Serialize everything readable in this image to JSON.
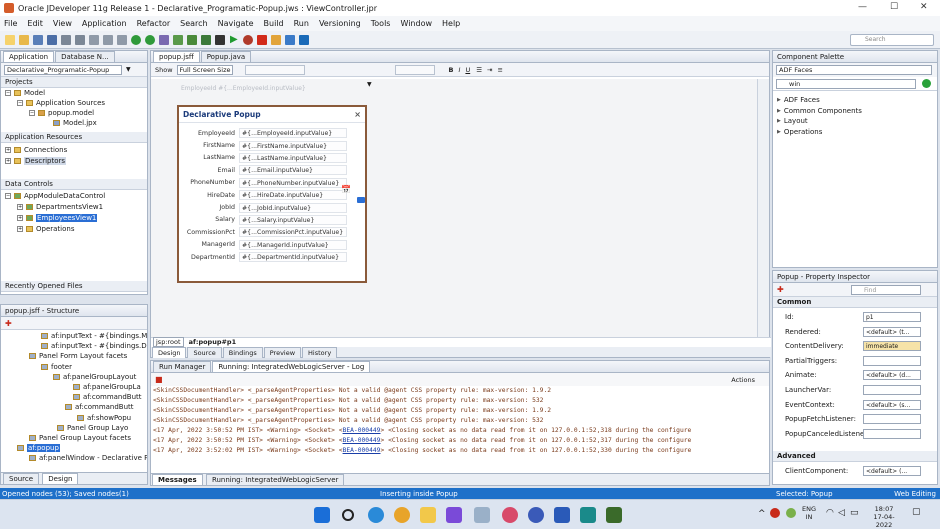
{
  "window": {
    "title": "Oracle JDeveloper 11g Release 1 - Declarative_Programatic-Popup.jws : ViewController.jpr"
  },
  "menu": [
    "File",
    "Edit",
    "View",
    "Application",
    "Refactor",
    "Search",
    "Navigate",
    "Build",
    "Run",
    "Versioning",
    "Tools",
    "Window",
    "Help"
  ],
  "search": {
    "placeholder": "Search"
  },
  "app_nav": {
    "tabs": [
      "Application",
      "Database N..."
    ],
    "project_select": "Declarative_Programatic-Popup",
    "projects_label": "Projects",
    "tree": [
      "Model",
      "Application Sources",
      "popup.model",
      "Model.jpx"
    ],
    "app_resources": "Application Resources",
    "resources_tree": [
      "Connections",
      "Descriptors"
    ],
    "data_controls": "Data Controls",
    "dc_tree": [
      "AppModuleDataControl",
      "DepartmentsView1",
      "EmployeesView1",
      "Operations"
    ],
    "recent": "Recently Opened Files"
  },
  "structure": {
    "title": "popup.jsff - Structure",
    "tree": [
      "af:inputText - #{bindings.Ma",
      "af:inputText - #{bindings.De",
      "Panel Form Layout facets",
      "footer",
      "af:panelGroupLayout",
      "af:panelGroupLa",
      "af:commandButt",
      "af:commandButt",
      "af:showPopu",
      "Panel Group Layo",
      "Panel Group Layout facets",
      "af:popup",
      "af:panelWindow - Declarative Pop"
    ],
    "tabs": [
      "Source",
      "Design"
    ]
  },
  "editor": {
    "tabs": [
      "popup.jsff",
      "Popup.java"
    ],
    "show_label": "Show",
    "screen_select": "Full Screen Size",
    "bg_hint": "EmployeeId  #{...EmployeeId.inputValue}",
    "breadcrumb": [
      "jsp:root",
      "af:popup#p1"
    ],
    "bottom_tabs": [
      "Design",
      "Source",
      "Bindings",
      "Preview",
      "History"
    ]
  },
  "dialog": {
    "title": "Declarative Popup",
    "close": "×",
    "rows": [
      {
        "label": "EmployeeId",
        "value": "#{...EmployeeId.inputValue}"
      },
      {
        "label": "FirstName",
        "value": "#{...FirstName.inputValue}"
      },
      {
        "label": "LastName",
        "value": "#{...LastName.inputValue}"
      },
      {
        "label": "Email",
        "value": "#{...Email.inputValue}"
      },
      {
        "label": "PhoneNumber",
        "value": "#{...PhoneNumber.inputValue}"
      },
      {
        "label": "HireDate",
        "value": "#{...HireDate.inputValue}"
      },
      {
        "label": "JobId",
        "value": "#{...JobId.inputValue}"
      },
      {
        "label": "Salary",
        "value": "#{...Salary.inputValue}"
      },
      {
        "label": "CommissionPct",
        "value": "#{...CommissionPct.inputValue}"
      },
      {
        "label": "ManagerId",
        "value": "#{...ManagerId.inputValue}"
      },
      {
        "label": "DepartmentId",
        "value": "#{...DepartmentId.inputValue}"
      }
    ]
  },
  "log": {
    "tabs": [
      "Run Manager",
      "Running: IntegratedWebLogicServer - Log"
    ],
    "actions": "Actions",
    "lines": [
      {
        "pre": "<SkinCSSDocumentHandler> <_parseAgentProperties> Not a valid @agent CSS property rule: max-version: 1.9.2",
        "link": "",
        "post": ""
      },
      {
        "pre": "<SkinCSSDocumentHandler> <_parseAgentProperties> Not a valid @agent CSS property rule: max-version: 532",
        "link": "",
        "post": ""
      },
      {
        "pre": "<SkinCSSDocumentHandler> <_parseAgentProperties> Not a valid @agent CSS property rule: max-version: 1.9.2",
        "link": "",
        "post": ""
      },
      {
        "pre": "<SkinCSSDocumentHandler> <_parseAgentProperties> Not a valid @agent CSS property rule: max-version: 532",
        "link": "",
        "post": ""
      },
      {
        "pre": "<17 Apr, 2022 3:50:52 PM IST> <Warning> <Socket> <",
        "link": "BEA-000449",
        "post": "> <Closing socket as no data read from it on 127.0.0.1:52,318 during the configure"
      },
      {
        "pre": "<17 Apr, 2022 3:50:52 PM IST> <Warning> <Socket> <",
        "link": "BEA-000449",
        "post": "> <Closing socket as no data read from it on 127.0.0.1:52,317 during the configure"
      },
      {
        "pre": "<17 Apr, 2022 3:52:02 PM IST> <Warning> <Socket> <",
        "link": "BEA-000449",
        "post": "> <Closing socket as no data read from it on 127.0.0.1:52,330 during the configure"
      }
    ],
    "bottom_tabs": [
      "Messages",
      "Running: IntegratedWebLogicServer"
    ]
  },
  "palette": {
    "title": "Component Palette",
    "select": "ADF Faces",
    "search_value": "win",
    "items": [
      "ADF Faces",
      "Common Components",
      "Layout",
      "Operations"
    ]
  },
  "inspector": {
    "title": "Popup - Property Inspector",
    "find_placeholder": "Find",
    "common": "Common",
    "advanced": "Advanced",
    "props": [
      {
        "label": "Id:",
        "value": "p1"
      },
      {
        "label": "Rendered:",
        "value": "<default> (t..."
      },
      {
        "label": "ContentDelivery:",
        "value": "immediate"
      },
      {
        "label": "PartialTriggers:",
        "value": ""
      },
      {
        "label": "Animate:",
        "value": "<default> (d..."
      },
      {
        "label": "LauncherVar:",
        "value": ""
      },
      {
        "label": "EventContext:",
        "value": "<default> (s..."
      },
      {
        "label": "PopupFetchListener:",
        "value": ""
      },
      {
        "label": "PopupCanceledListener:",
        "value": ""
      }
    ],
    "client_component": {
      "label": "ClientComponent:",
      "value": "<default> (..."
    }
  },
  "statusbar": {
    "left": "Opened nodes (53); Saved nodes(1)",
    "mid": "Inserting inside Popup",
    "sel": "Selected: Popup",
    "right": "Web Editing"
  },
  "tray": {
    "lang": "ENG",
    "region": "IN",
    "time": "18:07",
    "date": "17-04-2022"
  }
}
